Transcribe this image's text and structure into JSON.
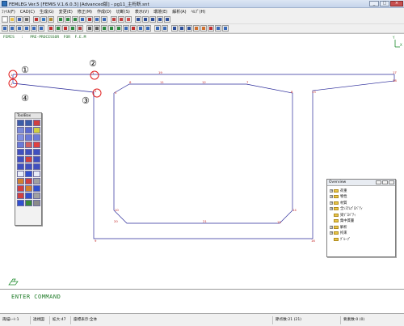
{
  "window": {
    "title": "FEMLEG Ver.5 [FEMIS V.1.6.0.3] [Advanced版] - pg11_主桁断.snt"
  },
  "menu": {
    "items": [
      "ﾌｧｲﾙ(F)",
      "CAD(C)",
      "生成(G)",
      "変更(E)",
      "修正(M)",
      "作成(D)",
      "切断(S)",
      "表示(V)",
      "環境(E)",
      "解析(A)",
      "ﾍﾙﾌﾟ(H)"
    ]
  },
  "canvas": {
    "header_line": "FEMIS   :   PRE-PROCESSOR  FOR  F.E.M",
    "axis_label_y": "Y",
    "axis_label_x": "X",
    "annotations": [
      "①",
      "②",
      "③",
      "④"
    ],
    "node_labels": [
      "1",
      "2",
      "3",
      "4",
      "5",
      "6",
      "7",
      "8",
      "9",
      "10",
      "11",
      "12",
      "13",
      "14",
      "15",
      "16",
      "17",
      "18",
      "19",
      "20",
      "21"
    ]
  },
  "toolbox": {
    "title": "ToolBox"
  },
  "overview": {
    "title": "Overview",
    "tabs": [
      "ov",
      "ov"
    ],
    "items": [
      {
        "label": "荷重",
        "toggle": "+"
      },
      {
        "label": "物性",
        "toggle": "+"
      },
      {
        "label": "材質",
        "toggle": "+"
      },
      {
        "label": "全ｼｽﾃﾑﾌﾟﾛﾊﾟﾃｨ",
        "toggle": "+"
      },
      {
        "label": "梁ﾌﾟﾛﾊﾟﾃｨ",
        "toggle": ""
      },
      {
        "label": "集中質量",
        "toggle": ""
      },
      {
        "label": "解析",
        "toggle": "+"
      },
      {
        "label": "拘束",
        "toggle": "+"
      },
      {
        "label": "ｸﾞﾙｰﾌﾟ",
        "toggle": ""
      }
    ]
  },
  "command": {
    "prompt": "ENTER COMMAND"
  },
  "status": {
    "cells": [
      "再描ﾚｰﾄ:1",
      "透視図",
      "拡大:47",
      "座標表示:全体",
      "節点数:21 (21)",
      "要素数:0 (0)"
    ]
  },
  "colors": {
    "outline": "#2b2b9a",
    "highlight": "#e01b1b",
    "command_text": "#1d7a26"
  }
}
